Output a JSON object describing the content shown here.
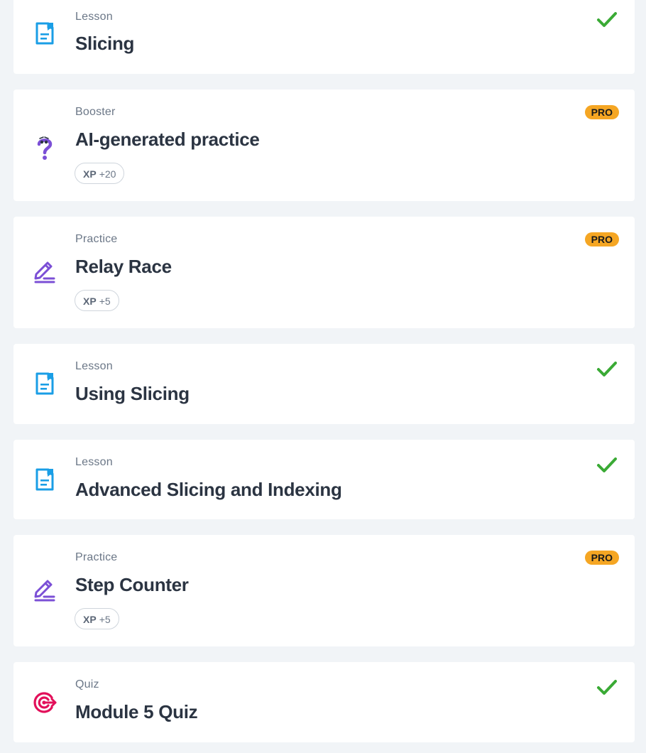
{
  "items": [
    {
      "type": "Lesson",
      "title": "Slicing",
      "icon": "lesson-icon",
      "status": "completed"
    },
    {
      "type": "Booster",
      "title": "AI-generated practice",
      "icon": "question-mark-icon",
      "badge": "PRO",
      "xp_label": "XP",
      "xp_value": "+20"
    },
    {
      "type": "Practice",
      "title": "Relay Race",
      "icon": "pencil-icon",
      "badge": "PRO",
      "xp_label": "XP",
      "xp_value": "+5"
    },
    {
      "type": "Lesson",
      "title": "Using Slicing",
      "icon": "lesson-icon",
      "status": "completed"
    },
    {
      "type": "Lesson",
      "title": "Advanced Slicing and Indexing",
      "icon": "lesson-icon",
      "status": "completed"
    },
    {
      "type": "Practice",
      "title": "Step Counter",
      "icon": "pencil-icon",
      "badge": "PRO",
      "xp_label": "XP",
      "xp_value": "+5"
    },
    {
      "type": "Quiz",
      "title": "Module 5 Quiz",
      "icon": "target-icon",
      "status": "completed"
    }
  ],
  "colors": {
    "lesson_icon": "#1a9ee6",
    "practice_icon": "#7b4fd6",
    "quiz_icon": "#e2105a",
    "check": "#3aaa35",
    "pro_badge": "#f5a623",
    "background": "#f1f4f7"
  }
}
